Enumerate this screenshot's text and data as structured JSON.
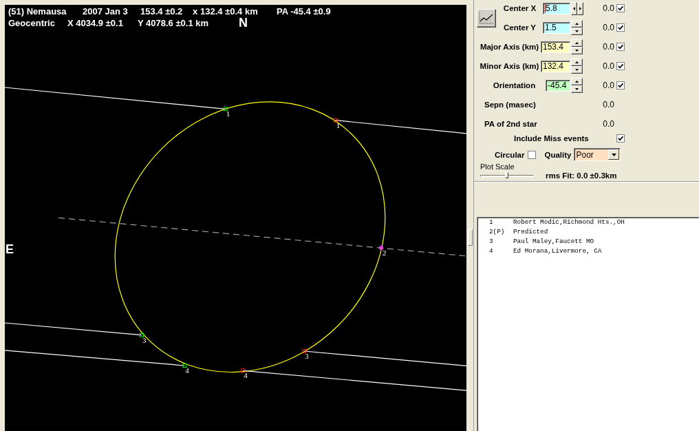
{
  "plot": {
    "title_parts": [
      "(51) Nemausa",
      "2007 Jan 3",
      "153.4 ±0.2",
      "x",
      "132.4 ±0.4 km",
      "PA -45.4 ±0.9"
    ],
    "geocentric_parts": [
      "Geocentric",
      "X 4034.9 ±0.1",
      "Y 4078.6 ±0.1 km"
    ],
    "north_label": "N",
    "east_label": "E",
    "chords": [
      {
        "kind": "observed",
        "start_label": "1",
        "end_label": "1"
      },
      {
        "kind": "predicted",
        "label": "2"
      },
      {
        "kind": "observed",
        "start_label": "3",
        "end_label": "3"
      },
      {
        "kind": "observed",
        "start_label": "4",
        "end_label": "4"
      }
    ]
  },
  "fit_panel": {
    "parameters": [
      {
        "label": "Center X",
        "value": "5.8",
        "kind": "position",
        "horizontal_spin": true,
        "focused": true,
        "color": "#c0ffff",
        "residual": "0.0",
        "checked": true
      },
      {
        "label": "Center Y",
        "value": "1.5",
        "kind": "position",
        "horizontal_spin": false,
        "focused": false,
        "color": "#c0ffff",
        "residual": "0.0",
        "checked": true
      },
      {
        "label": "Major Axis (km)",
        "value": "153.4",
        "kind": "axis",
        "horizontal_spin": false,
        "focused": false,
        "color": "#ffffc0",
        "residual": "0.0",
        "checked": true
      },
      {
        "label": "Minor Axis (km)",
        "value": "132.4",
        "kind": "axis",
        "horizontal_spin": false,
        "focused": false,
        "color": "#ffffc0",
        "residual": "0.0",
        "checked": true
      },
      {
        "label": "Orientation",
        "value": "-45.4",
        "kind": "angle",
        "horizontal_spin": false,
        "focused": false,
        "color": "#c0ffc0",
        "residual": "0.0",
        "checked": true
      }
    ],
    "sepn": {
      "label": "Sepn (masec)",
      "value": "0.0"
    },
    "pa_second_star": {
      "label": "PA of 2nd star",
      "value": "0.0"
    },
    "include_miss": {
      "label": "Include Miss events",
      "checked": true
    },
    "circular": {
      "label": "Circular",
      "checked": false
    },
    "quality": {
      "label": "Quality",
      "value": "Poor"
    },
    "plot_scale": {
      "label": "Plot Scale",
      "level": 0.5
    },
    "rms_fit": "rms Fit: 0.0 ±0.3km"
  },
  "observers": [
    {
      "number": "1",
      "name": "Robert Modic,Richmond Hts.,OH"
    },
    {
      "number": "2(P)",
      "name": "Predicted"
    },
    {
      "number": "3",
      "name": "Paul Maley,Faucett MO"
    },
    {
      "number": "4",
      "name": "Ed Morana,Livermore, CA"
    }
  ]
}
